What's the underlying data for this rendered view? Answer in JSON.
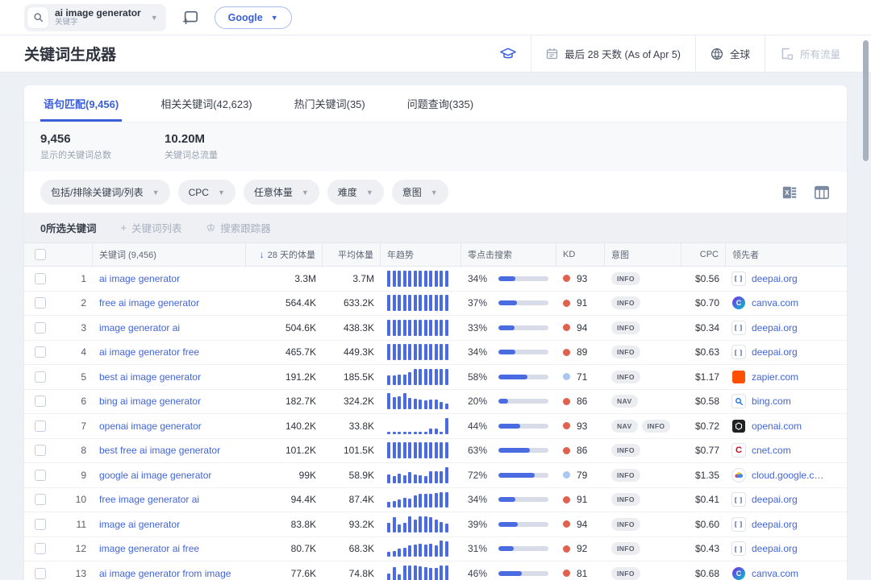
{
  "topbar": {
    "search": {
      "value": "ai image generator",
      "label": "关键字"
    },
    "database_button": "Google"
  },
  "header": {
    "title": "关键词生成器",
    "date_filter": "最后 28 天数 (As of Apr 5)",
    "location_filter": "全球",
    "traffic_filter": "所有流量"
  },
  "tabs": [
    {
      "label": "语句匹配(9,456)",
      "active": true
    },
    {
      "label": "相关关键词(42,623)",
      "active": false
    },
    {
      "label": "热门关键词(35)",
      "active": false
    },
    {
      "label": "问题查询(335)",
      "active": false
    }
  ],
  "stats": [
    {
      "value": "9,456",
      "label": "显示的关键词总数"
    },
    {
      "value": "10.20M",
      "label": "关键词总流量"
    }
  ],
  "filters": [
    "包括/排除关键词/列表",
    "CPC",
    "任意体量",
    "难度",
    "意图"
  ],
  "selection_bar": {
    "selected_count": "0所选关键词",
    "add_to_list": "关键词列表",
    "tracker": "搜索跟踪器"
  },
  "table": {
    "columns": {
      "keyword": "关键词 (9,456)",
      "volume": "28 天的体量",
      "avg_volume": "平均体量",
      "trend": "年趋势",
      "zero_click": "零点击搜索",
      "kd": "KD",
      "intent": "意图",
      "cpc": "CPC",
      "leader": "领先者"
    },
    "rows": [
      {
        "n": 1,
        "keyword": "ai image generator",
        "vol": "3.3M",
        "avg": "3.7M",
        "trend": [
          1,
          1,
          1,
          1,
          1,
          1,
          1,
          1,
          1,
          1,
          1,
          1
        ],
        "zero": "34%",
        "zero_pct": 34,
        "kd": 93,
        "kd_level": "high",
        "intents": [
          "INFO"
        ],
        "cpc": "$0.56",
        "site": "deepai.org",
        "icon": "deepai"
      },
      {
        "n": 2,
        "keyword": "free ai image generator",
        "vol": "564.4K",
        "avg": "633.2K",
        "trend": [
          1,
          1,
          1,
          1,
          1,
          1,
          1,
          1,
          1,
          1,
          1,
          1
        ],
        "zero": "37%",
        "zero_pct": 37,
        "kd": 91,
        "kd_level": "high",
        "intents": [
          "INFO"
        ],
        "cpc": "$0.70",
        "site": "canva.com",
        "icon": "canva"
      },
      {
        "n": 3,
        "keyword": "image generator ai",
        "vol": "504.6K",
        "avg": "438.3K",
        "trend": [
          1,
          1,
          1,
          1,
          1,
          1,
          1,
          1,
          1,
          1,
          1,
          1
        ],
        "zero": "33%",
        "zero_pct": 33,
        "kd": 94,
        "kd_level": "high",
        "intents": [
          "INFO"
        ],
        "cpc": "$0.34",
        "site": "deepai.org",
        "icon": "deepai"
      },
      {
        "n": 4,
        "keyword": "ai image generator free",
        "vol": "465.7K",
        "avg": "449.3K",
        "trend": [
          1,
          1,
          1,
          1,
          1,
          1,
          1,
          1,
          1,
          1,
          1,
          1
        ],
        "zero": "34%",
        "zero_pct": 34,
        "kd": 89,
        "kd_level": "high",
        "intents": [
          "INFO"
        ],
        "cpc": "$0.63",
        "site": "deepai.org",
        "icon": "deepai"
      },
      {
        "n": 5,
        "keyword": "best ai image generator",
        "vol": "191.2K",
        "avg": "185.5K",
        "trend": [
          0.6,
          0.6,
          0.65,
          0.65,
          0.8,
          1,
          1,
          1,
          1,
          1,
          1,
          1
        ],
        "zero": "58%",
        "zero_pct": 58,
        "kd": 71,
        "kd_level": "mid",
        "intents": [
          "INFO"
        ],
        "cpc": "$1.17",
        "site": "zapier.com",
        "icon": "zapier"
      },
      {
        "n": 6,
        "keyword": "bing ai image generator",
        "vol": "182.7K",
        "avg": "324.2K",
        "trend": [
          1,
          0.75,
          0.8,
          1,
          0.7,
          0.65,
          0.6,
          0.55,
          0.6,
          0.6,
          0.45,
          0.35
        ],
        "zero": "20%",
        "zero_pct": 20,
        "kd": 86,
        "kd_level": "high",
        "intents": [
          "NAV"
        ],
        "cpc": "$0.58",
        "site": "bing.com",
        "icon": "bing"
      },
      {
        "n": 7,
        "keyword": "openai image generator",
        "vol": "140.2K",
        "avg": "33.8K",
        "trend": [
          0.15,
          0.15,
          0.15,
          0.15,
          0.15,
          0.15,
          0.15,
          0.15,
          0.35,
          0.35,
          0.15,
          1
        ],
        "zero": "44%",
        "zero_pct": 44,
        "kd": 93,
        "kd_level": "high",
        "intents": [
          "NAV",
          "INFO"
        ],
        "cpc": "$0.72",
        "site": "openai.com",
        "icon": "openai"
      },
      {
        "n": 8,
        "keyword": "best free ai image generator",
        "vol": "101.2K",
        "avg": "101.5K",
        "trend": [
          1,
          1,
          1,
          1,
          1,
          1,
          1,
          1,
          1,
          1,
          1,
          1
        ],
        "zero": "63%",
        "zero_pct": 63,
        "kd": 86,
        "kd_level": "high",
        "intents": [
          "INFO"
        ],
        "cpc": "$0.77",
        "site": "cnet.com",
        "icon": "cnet"
      },
      {
        "n": 9,
        "keyword": "google ai image generator",
        "vol": "99K",
        "avg": "58.9K",
        "trend": [
          0.55,
          0.45,
          0.6,
          0.5,
          0.7,
          0.55,
          0.5,
          0.45,
          0.75,
          0.75,
          0.75,
          1
        ],
        "zero": "72%",
        "zero_pct": 72,
        "kd": 79,
        "kd_level": "mid",
        "intents": [
          "INFO"
        ],
        "cpc": "$1.35",
        "site": "cloud.google.c…",
        "icon": "gcloud"
      },
      {
        "n": 10,
        "keyword": "free image generator ai",
        "vol": "94.4K",
        "avg": "87.4K",
        "trend": [
          0.35,
          0.4,
          0.5,
          0.6,
          0.55,
          0.75,
          0.85,
          0.85,
          0.85,
          0.9,
          0.95,
          0.95
        ],
        "zero": "34%",
        "zero_pct": 34,
        "kd": 91,
        "kd_level": "high",
        "intents": [
          "INFO"
        ],
        "cpc": "$0.41",
        "site": "deepai.org",
        "icon": "deepai"
      },
      {
        "n": 11,
        "keyword": "image ai generator",
        "vol": "83.8K",
        "avg": "93.2K",
        "trend": [
          0.6,
          0.95,
          0.5,
          0.6,
          1,
          0.8,
          1,
          1,
          0.95,
          0.8,
          0.65,
          0.55
        ],
        "zero": "39%",
        "zero_pct": 39,
        "kd": 94,
        "kd_level": "high",
        "intents": [
          "INFO"
        ],
        "cpc": "$0.60",
        "site": "deepai.org",
        "icon": "deepai"
      },
      {
        "n": 12,
        "keyword": "image generator ai free",
        "vol": "80.7K",
        "avg": "68.3K",
        "trend": [
          0.3,
          0.35,
          0.5,
          0.55,
          0.7,
          0.75,
          0.8,
          0.75,
          0.8,
          0.7,
          1,
          0.95
        ],
        "zero": "31%",
        "zero_pct": 31,
        "kd": 92,
        "kd_level": "high",
        "intents": [
          "INFO"
        ],
        "cpc": "$0.43",
        "site": "deepai.org",
        "icon": "deepai"
      },
      {
        "n": 13,
        "keyword": "ai image generator from image",
        "vol": "77.6K",
        "avg": "74.8K",
        "trend": [
          0.5,
          0.9,
          0.45,
          1,
          1,
          1,
          0.95,
          0.9,
          0.85,
          0.85,
          1,
          1
        ],
        "zero": "46%",
        "zero_pct": 46,
        "kd": 81,
        "kd_level": "high",
        "intents": [
          "INFO"
        ],
        "cpc": "$0.68",
        "site": "canva.com",
        "icon": "canva"
      }
    ]
  },
  "colors": {
    "accent": "#3b5ed9",
    "trend_bar": "#4a6ce0",
    "kd_high": "#e0614e",
    "kd_mid": "#a9c7f1"
  }
}
